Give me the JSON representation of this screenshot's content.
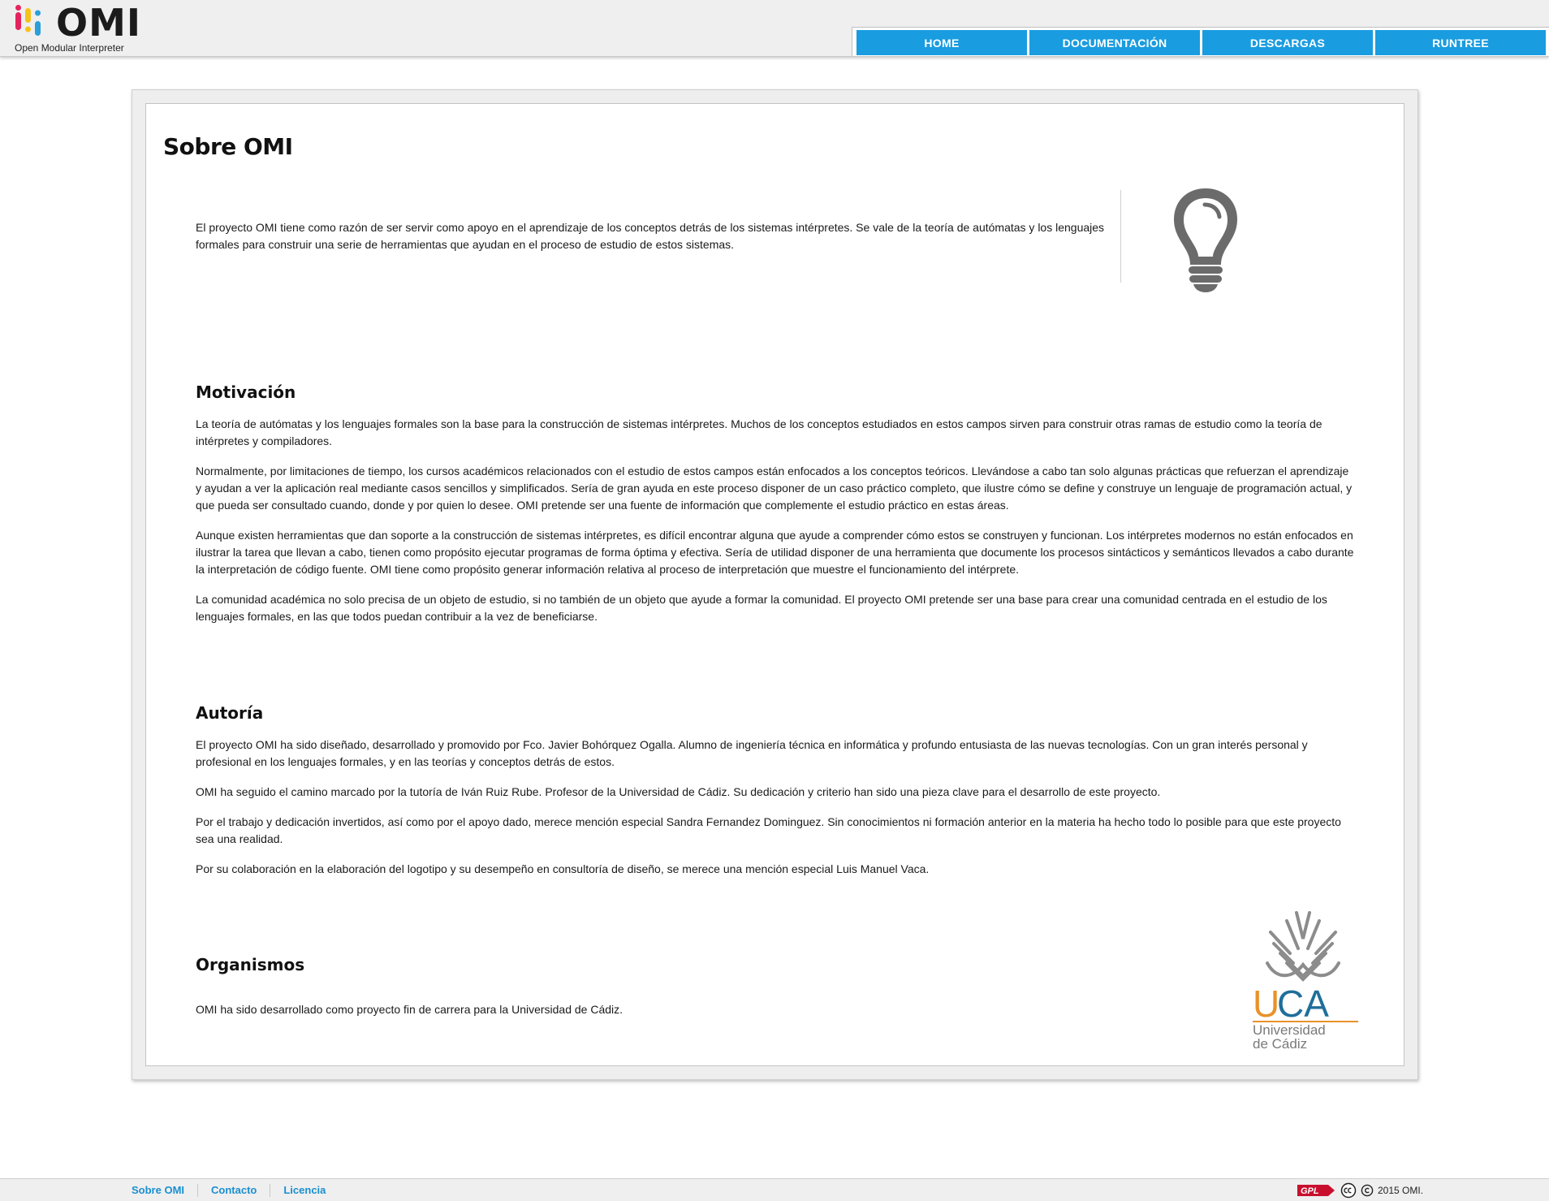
{
  "header": {
    "logo_word": "OMI",
    "logo_tagline": "Open Modular Interpreter",
    "logo_dot_colors": [
      "#e5245e",
      "#f6c21b",
      "#2a9fd8",
      "#1b1b1b"
    ]
  },
  "nav": {
    "items": [
      {
        "label": "HOME"
      },
      {
        "label": "DOCUMENTACIÓN"
      },
      {
        "label": "DESCARGAS"
      },
      {
        "label": "RUNTREE"
      }
    ],
    "color": "#1a9ce0"
  },
  "page": {
    "title": "Sobre OMI",
    "intro_line1": "El proyecto OMI tiene como razón de ser servir como apoyo en el aprendizaje de los conceptos detrás de los sistemas intérpretes. Se vale de la teoría de autómatas y los lenguajes",
    "intro_line2": "formales para construir una serie de herramientas que ayudan en el proceso de estudio de estos sistemas.",
    "intro_icon": "lightbulb-icon",
    "motivacion": {
      "title": "Motivación",
      "p1": "La teoría de autómatas y los lenguajes formales son la base para la construcción de sistemas intérpretes. Muchos de los conceptos estudiados en estos campos sirven para construir otras ramas de estudio como la teoría de intérpretes y compiladores.",
      "p2": "Normalmente, por limitaciones de tiempo, los cursos académicos relacionados con el estudio de estos campos están enfocados a los conceptos teóricos. Llevándose a cabo tan solo algunas prácticas que refuerzan el aprendizaje y ayudan a ver la aplicación real mediante casos sencillos y simplificados. Sería de gran ayuda en este proceso disponer de un caso práctico completo, que ilustre cómo se define y construye un lenguaje de programación actual, y que pueda ser consultado cuando, donde y por quien lo desee. OMI pretende ser una fuente de información que complemente el estudio práctico en estas áreas.",
      "p3": "Aunque existen herramientas que dan soporte a la construcción de sistemas intérpretes, es difícil encontrar alguna que ayude a comprender cómo estos se construyen y funcionan. Los intérpretes modernos no están enfocados en ilustrar la tarea que llevan a cabo, tienen como propósito ejecutar programas de forma óptima y efectiva. Sería de utilidad disponer de una herramienta que documente los procesos sintácticos y semánticos llevados a cabo durante la interpretación de código fuente. OMI tiene como propósito generar información relativa al proceso de interpretación que muestre el funcionamiento del intérprete.",
      "p4": "La comunidad académica no solo precisa de un objeto de estudio, si no también de un objeto que ayude a formar la comunidad. El proyecto OMI pretende ser una base para crear una comunidad centrada en el estudio de los lenguajes formales, en las que todos puedan contribuir a la vez de beneficiarse."
    },
    "autoria": {
      "title": "Autoría",
      "p1": "El proyecto OMI ha sido diseñado, desarrollado y promovido por Fco. Javier Bohórquez Ogalla. Alumno de ingeniería técnica en informática y profundo entusiasta de las nuevas tecnologías. Con un gran interés personal y profesional en los lenguajes formales, y en las teorías y conceptos detrás de estos.",
      "p2": "OMI ha seguido el camino marcado por la tutoría de Iván Ruiz Rube. Profesor de la Universidad de Cádiz. Su dedicación y criterio han sido una pieza clave para el desarrollo de este proyecto.",
      "p3": "Por el trabajo y dedicación invertidos, así como por el apoyo dado, merece mención especial Sandra Fernandez Dominguez. Sin conocimientos ni formación anterior en la materia ha hecho todo lo posible para que este proyecto sea una realidad.",
      "p4": "Por su colaboración en la elaboración del logotipo y su desempeño en consultoría de diseño, se merece una mención especial Luis Manuel Vaca."
    },
    "organismos": {
      "title": "Organismos",
      "p1": "OMI ha sido desarrollado como proyecto fin de carrera para la Universidad de Cádiz.",
      "logo_u": "U",
      "logo_ca": "CA",
      "logo_line1": "Universidad",
      "logo_line2": "de Cádiz"
    }
  },
  "footer": {
    "links": [
      {
        "label": "Sobre OMI"
      },
      {
        "label": "Contacto"
      },
      {
        "label": "Licencia"
      }
    ],
    "gpl_label": "GPL",
    "copyright": "2015 OMI."
  },
  "colors": {
    "accent": "#1a9ce0",
    "uca_orange": "#e8922a",
    "uca_blue": "#1f6f9a",
    "bulb_gray": "#6b6b6b"
  }
}
